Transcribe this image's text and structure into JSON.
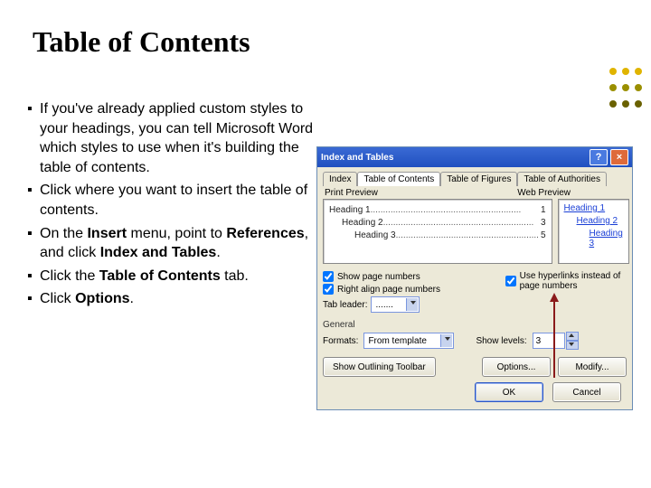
{
  "slide": {
    "title": "Table of Contents",
    "bullets": [
      {
        "pre": "If you've already applied custom styles to your headings, you can tell Microsoft Word which styles to use when it's building the table of contents."
      },
      {
        "pre": "Click where you want to insert the table of contents."
      },
      {
        "parts": [
          "On the ",
          "Insert",
          " menu, point to ",
          "References",
          ", and click ",
          "Index and Tables",
          "."
        ]
      },
      {
        "parts": [
          "Click the ",
          "Table of Contents",
          " tab."
        ]
      },
      {
        "parts": [
          "Click ",
          "Options",
          "."
        ]
      }
    ]
  },
  "dialog": {
    "title": "Index and Tables",
    "tabs": [
      "Index",
      "Table of Contents",
      "Table of Figures",
      "Table of Authorities"
    ],
    "activeTab": 1,
    "printPreviewLabel": "Print Preview",
    "webPreviewLabel": "Web Preview",
    "printPreview": [
      {
        "indent": 0,
        "label": "Heading 1",
        "page": "1"
      },
      {
        "indent": 1,
        "label": "Heading 2",
        "page": "3"
      },
      {
        "indent": 2,
        "label": "Heading 3",
        "page": "5"
      }
    ],
    "webPreview": [
      {
        "indent": 0,
        "label": "Heading 1"
      },
      {
        "indent": 1,
        "label": "Heading 2"
      },
      {
        "indent": 2,
        "label": "Heading 3"
      }
    ],
    "showPageNumbers": {
      "label": "Show page numbers",
      "checked": true
    },
    "rightAlign": {
      "label": "Right align page numbers",
      "checked": true
    },
    "useHyperlinks": {
      "label": "Use hyperlinks instead of page numbers",
      "checked": true
    },
    "tabLeader": {
      "label": "Tab leader:",
      "value": "......."
    },
    "generalLabel": "General",
    "formats": {
      "label": "Formats:",
      "value": "From template"
    },
    "showLevels": {
      "label": "Show levels:",
      "value": "3"
    },
    "buttons": {
      "outline": "Show Outlining Toolbar",
      "options": "Options...",
      "modify": "Modify...",
      "ok": "OK",
      "cancel": "Cancel"
    }
  },
  "dot_colors": [
    "#e0b400",
    "#e0b400",
    "#e0b400",
    "#9a8f00",
    "#9a8f00",
    "#9a8f00",
    "#6a6100",
    "#6a6100",
    "#6a6100"
  ]
}
